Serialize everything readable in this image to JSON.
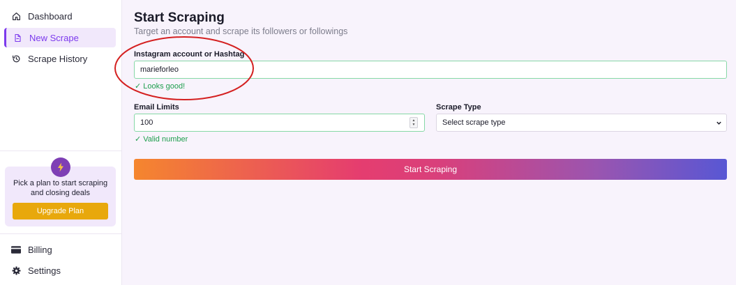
{
  "sidebar": {
    "items": [
      {
        "label": "Dashboard",
        "icon": "home-icon"
      },
      {
        "label": "New Scrape",
        "icon": "document-icon",
        "active": true
      },
      {
        "label": "Scrape History",
        "icon": "history-icon"
      }
    ],
    "promo": {
      "icon": "lightning-icon",
      "text": "Pick a plan to start scraping and closing deals",
      "button_label": "Upgrade Plan"
    },
    "footer_items": [
      {
        "label": "Billing",
        "icon": "credit-card-icon"
      },
      {
        "label": "Settings",
        "icon": "gear-icon"
      }
    ]
  },
  "main": {
    "title": "Start Scraping",
    "subtitle": "Target an account and scrape its followers or followings",
    "account_field": {
      "label": "Instagram account or Hashtag",
      "value": "marieforleo",
      "validation": "✓ Looks good!"
    },
    "email_field": {
      "label": "Email Limits",
      "value": "100",
      "validation": "✓ Valid number"
    },
    "scrape_type": {
      "label": "Scrape Type",
      "selected": "Select scrape type"
    },
    "submit_label": "Start Scraping"
  },
  "colors": {
    "accent": "#7c3aed",
    "upgrade": "#e8a80c",
    "valid": "#1e9e4d",
    "annotation": "#d42020"
  }
}
